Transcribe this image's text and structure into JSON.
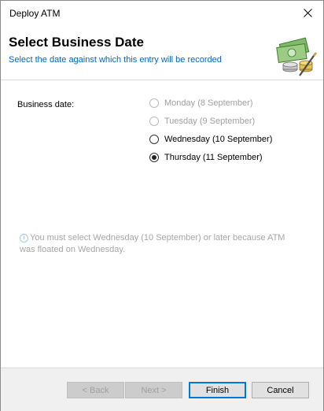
{
  "window": {
    "title": "Deploy ATM"
  },
  "header": {
    "title": "Select Business Date",
    "subtitle": "Select the date against which this entry will be recorded",
    "icon": "money-icon"
  },
  "form": {
    "field_label": "Business date:",
    "options": [
      {
        "label": "Monday (8 September)",
        "enabled": false,
        "selected": false
      },
      {
        "label": "Tuesday (9 September)",
        "enabled": false,
        "selected": false
      },
      {
        "label": "Wednesday (10 September)",
        "enabled": true,
        "selected": false
      },
      {
        "label": "Thursday (11 September)",
        "enabled": true,
        "selected": true
      }
    ],
    "info_icon": "i",
    "info_text": "You must select Wednesday (10 September) or later because ATM was floated on Wednesday."
  },
  "buttons": {
    "back": "< Back",
    "next": "Next >",
    "finish": "Finish",
    "cancel": "Cancel"
  },
  "colors": {
    "accent": "#0078d7",
    "subtitle": "#0066cc"
  }
}
